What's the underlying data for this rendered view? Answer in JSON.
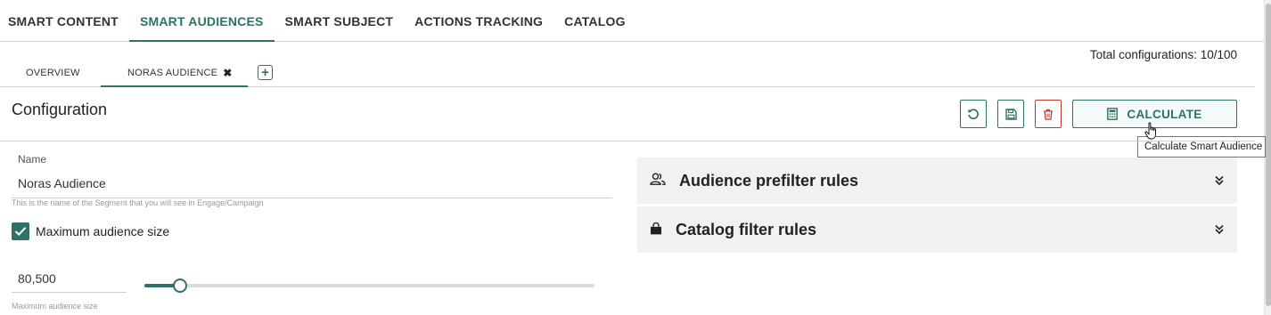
{
  "nav": {
    "items": [
      "SMART CONTENT",
      "SMART AUDIENCES",
      "SMART SUBJECT",
      "ACTIONS TRACKING",
      "CATALOG"
    ],
    "active_index": 1
  },
  "summary": {
    "total_configurations": "Total configurations: 10/100"
  },
  "tabs": {
    "overview": "OVERVIEW",
    "open": "NORAS AUDIENCE",
    "close_icon": "close-icon",
    "add_icon": "plus-box-icon"
  },
  "config": {
    "title": "Configuration",
    "calculate_label": "CALCULATE",
    "calculate_tooltip": "Calculate Smart Audience",
    "icons": {
      "reset": "undo-icon",
      "save": "save-icon",
      "delete": "trash-icon",
      "calculate": "calculator-icon"
    }
  },
  "form": {
    "name_label": "Name",
    "name_value": "Noras Audience",
    "name_hint": "This is the name of the Segment that you will see in Engage/Campaign",
    "max_size_checked": true,
    "max_size_label": "Maximum audience size",
    "size_value": "80,500",
    "size_hint": "Maximum audience size",
    "slider_fraction": 0.08
  },
  "panels": [
    {
      "title": "Audience prefilter rules",
      "icon": "users-icon"
    },
    {
      "title": "Catalog filter rules",
      "icon": "shopping-bag-icon"
    }
  ],
  "colors": {
    "accent": "#2e7265",
    "danger": "#c0392b",
    "panel_bg": "#f1f1f1"
  }
}
